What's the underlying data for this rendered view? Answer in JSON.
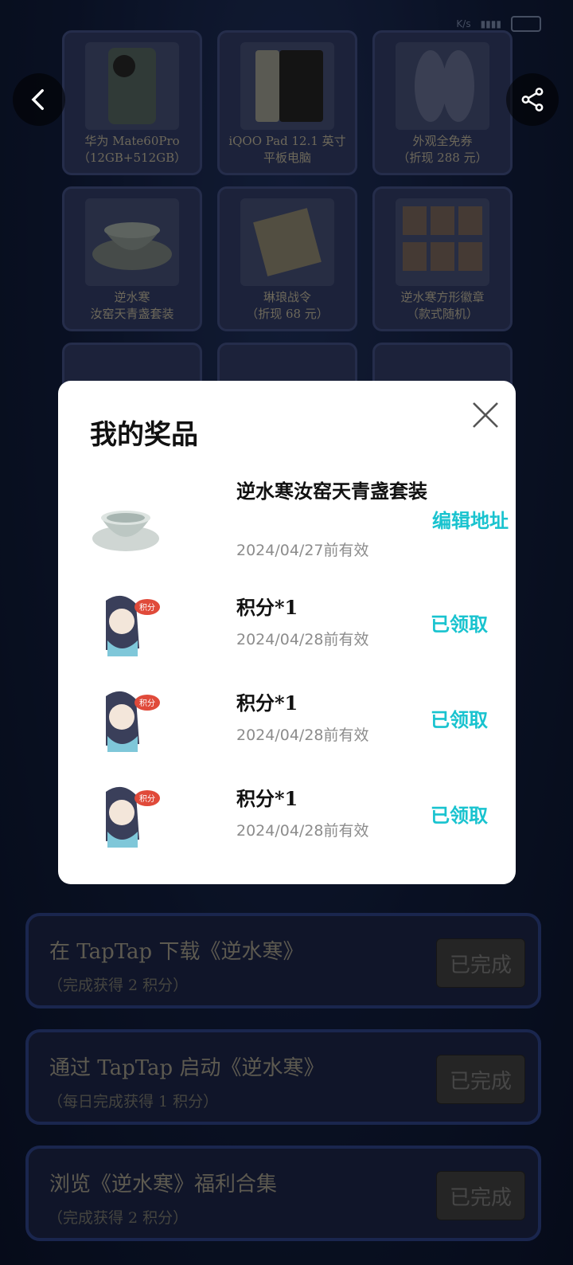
{
  "status_bar": {
    "speed": "K/s"
  },
  "nav": {
    "back_icon": "chevron-left-icon",
    "share_icon": "share-icon"
  },
  "prizes_grid": [
    {
      "caption_line1": "华为 Mate60Pro",
      "caption_line2": "（12GB+512GB）"
    },
    {
      "caption_line1": "iQOO Pad 12.1 英寸",
      "caption_line2": "平板电脑"
    },
    {
      "caption_line1": "外观全免券",
      "caption_line2": "（折现 288 元）"
    },
    {
      "caption_line1": "逆水寒",
      "caption_line2": "汝窑天青盏套装"
    },
    {
      "caption_line1": "琳琅战令",
      "caption_line2": "（折现 68 元）"
    },
    {
      "caption_line1": "逆水寒方形徽章",
      "caption_line2": "（款式随机）"
    }
  ],
  "tasks": [
    {
      "title": "在 TapTap 下载《逆水寒》",
      "subtitle": "（完成获得 2 积分）",
      "button": "已完成"
    },
    {
      "title": "通过 TapTap 启动《逆水寒》",
      "subtitle": "（每日完成获得 1 积分）",
      "button": "已完成"
    },
    {
      "title": "浏览《逆水寒》福利合集",
      "subtitle": "（完成获得 2 积分）",
      "button": "已完成"
    }
  ],
  "modal": {
    "title": "我的奖品",
    "items": [
      {
        "name": "逆水寒汝窑天青盏套装",
        "date": "2024/04/27前有效",
        "action": "编辑地址"
      },
      {
        "name": "积分*1",
        "date": "2024/04/28前有效",
        "action": "已领取",
        "badge": "积分"
      },
      {
        "name": "积分*1",
        "date": "2024/04/28前有效",
        "action": "已领取",
        "badge": "积分"
      },
      {
        "name": "积分*1",
        "date": "2024/04/28前有效",
        "action": "已领取",
        "badge": "积分"
      }
    ]
  },
  "colors": {
    "accent": "#19c3cf",
    "modal_bg": "#ffffff"
  }
}
